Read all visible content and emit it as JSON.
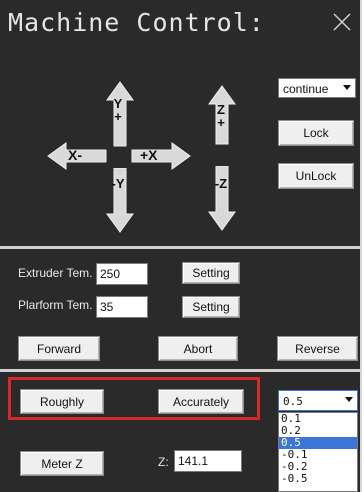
{
  "window": {
    "title": "Machine Control:"
  },
  "motion": {
    "axis_labels": {
      "y_up": "Y+",
      "y_down": "-Y",
      "x_minus": "X-",
      "x_plus": "+X",
      "z_up": "Z+",
      "z_down": "-Z"
    },
    "mode_select": {
      "value": "continue"
    },
    "lock_label": "Lock",
    "unlock_label": "UnLock"
  },
  "temps": {
    "extruder_label": "Extruder Tem.",
    "extruder_value": "250",
    "platform_label": "Plarform Tem.",
    "platform_value": "35",
    "setting_label": "Setting"
  },
  "actions": {
    "forward": "Forward",
    "abort": "Abort",
    "reverse": "Reverse"
  },
  "calibration": {
    "roughly": "Roughly",
    "accurately": "Accurately",
    "step_select": {
      "value": "0.5",
      "options": [
        "0.1",
        "0.2",
        "0.5",
        "-0.1",
        "-0.2",
        "-0.5"
      ],
      "selected_index": 2
    },
    "meter_z": "Meter Z",
    "z_label": "Z:",
    "z_value": "141.1"
  },
  "colors": {
    "panel_bg": "#2a2a2a",
    "highlight_box": "#d42a2a",
    "selection": "#3b75d6"
  }
}
